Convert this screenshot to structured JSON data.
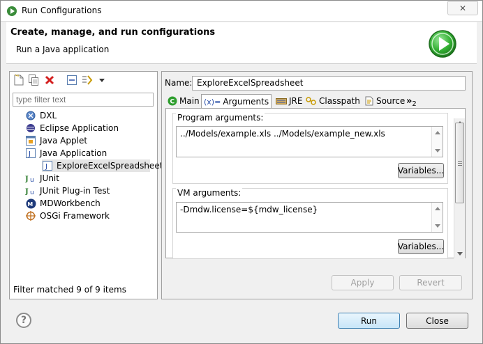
{
  "window": {
    "title": "Run Configurations",
    "close_glyph": "✕"
  },
  "header": {
    "title": "Create, manage, and run configurations",
    "subtitle": "Run a Java application",
    "icon": "run-icon"
  },
  "toolbar": {
    "items": [
      "new-launch-config-icon",
      "duplicate-icon",
      "delete-icon",
      "collapse-all-icon",
      "filter-icon",
      "view-menu-icon"
    ]
  },
  "filter": {
    "placeholder": "type filter text"
  },
  "tree": {
    "items": [
      {
        "label": "DXL",
        "icon": "dxl-icon"
      },
      {
        "label": "Eclipse Application",
        "icon": "eclipse-icon"
      },
      {
        "label": "Java Applet",
        "icon": "java-applet-icon"
      },
      {
        "label": "Java Application",
        "icon": "java-application-icon"
      },
      {
        "label": "ExploreExcelSpreadsheet",
        "icon": "java-class-icon",
        "child": true,
        "selected": true
      },
      {
        "label": "JUnit",
        "icon": "junit-icon"
      },
      {
        "label": "JUnit Plug-in Test",
        "icon": "junit-plugin-icon"
      },
      {
        "label": "MDWorkbench",
        "icon": "mdworkbench-icon"
      },
      {
        "label": "OSGi Framework",
        "icon": "osgi-icon"
      }
    ]
  },
  "filter_status": "Filter matched 9 of 9 items",
  "config": {
    "name_label": "Name:",
    "name_value": "ExploreExcelSpreadsheet",
    "tabs": [
      {
        "label": "Main",
        "icon": "main-tab-icon"
      },
      {
        "label": "Arguments",
        "icon_text": "(x)=",
        "active": true
      },
      {
        "label": "JRE",
        "icon": "jre-icon"
      },
      {
        "label": "Classpath",
        "icon": "classpath-icon"
      },
      {
        "label": "Source",
        "icon": "source-icon"
      }
    ],
    "more_tabs": {
      "glyph": "»",
      "count": "2"
    },
    "program_args": {
      "label": "Program arguments:",
      "value": "../Models/example.xls ../Models/example_new.xls",
      "variables_button": "Variables..."
    },
    "vm_args": {
      "label": "VM arguments:",
      "value": "-Dmdw.license=${mdw_license}",
      "variables_button": "Variables..."
    },
    "apply_button": "Apply",
    "revert_button": "Revert"
  },
  "footer": {
    "help_glyph": "?",
    "run_button": "Run",
    "close_button": "Close"
  },
  "colors": {
    "accent_green": "#2e9e2e",
    "delete_red": "#d42020",
    "tab_icon_blue": "#2a4fa8"
  }
}
